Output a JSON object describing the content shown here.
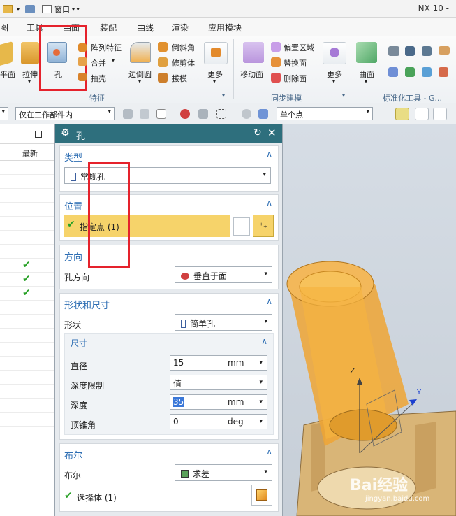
{
  "title_bar": {
    "window_menu": "窗口",
    "app_name": "NX 10 -"
  },
  "menu_tabs": [
    "图",
    "工具",
    "曲面",
    "装配",
    "曲线",
    "渲染",
    "应用模块"
  ],
  "ribbon": {
    "plane": "平面",
    "extrude": "拉伸",
    "hole": "孔",
    "pattern": "阵列特征",
    "unite": "合并",
    "shell": "抽壳",
    "edge_blend": "边倒圆",
    "chamfer": "倒斜角",
    "trim_body": "修剪体",
    "draft": "拔模",
    "more": "更多",
    "feature_group": "特征",
    "move_face": "移动面",
    "offset_region": "偏置区域",
    "replace_face": "替换面",
    "delete_face": "删除面",
    "more2": "更多",
    "sync_group": "同步建模",
    "surface": "曲面",
    "std_tools": "标准化工具 - G..."
  },
  "selbar": {
    "filter": "仅在工作部件内",
    "snap": "单个点"
  },
  "nav": {
    "latest": "最新",
    "checks": [
      false,
      false,
      false,
      false,
      false,
      false,
      false,
      true,
      true,
      true,
      false,
      false,
      false,
      false,
      false,
      false,
      false,
      false,
      false,
      false,
      false,
      false,
      false,
      false,
      false
    ]
  },
  "dialog": {
    "title": "孔",
    "type": {
      "header": "类型",
      "value": "常规孔"
    },
    "position": {
      "header": "位置",
      "point": "指定点 (1)"
    },
    "direction": {
      "header": "方向",
      "label": "孔方向",
      "value": "垂直于面"
    },
    "form": {
      "header": "形状和尺寸",
      "shape_label": "形状",
      "shape_value": "简单孔",
      "dims_header": "尺寸",
      "diameter_label": "直径",
      "diameter_value": "15",
      "diameter_unit": "mm",
      "depth_limit_label": "深度限制",
      "depth_limit_value": "值",
      "depth_label": "深度",
      "depth_value": "35",
      "depth_unit": "mm",
      "tip_label": "顶锥角",
      "tip_value": "0",
      "tip_unit": "deg"
    },
    "boolean": {
      "header": "布尔",
      "label": "布尔",
      "value": "求差",
      "select_body": "选择体 (1)"
    }
  },
  "viewport": {
    "axis_z": "Z",
    "axis_y": "Y",
    "axis_x": "X",
    "watermark": "Bai经验",
    "watermark_url": "jingyan.baidu.com"
  },
  "colors": {
    "accent": "#2f6fb4",
    "title": "#2e6f7d",
    "highlight": "#f6d36a",
    "red_box": "#e5222c",
    "part": "#f0a530"
  }
}
